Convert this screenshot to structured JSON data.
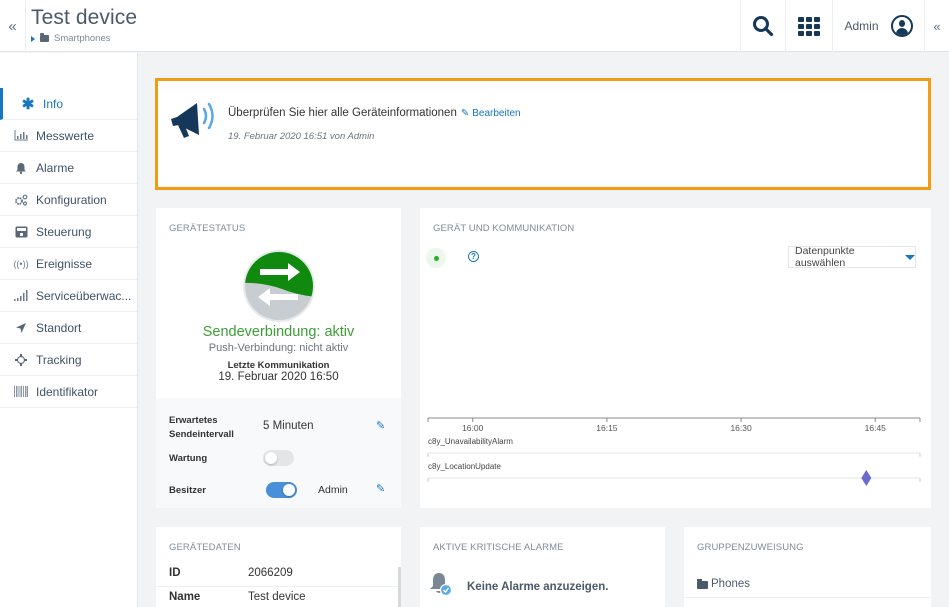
{
  "header": {
    "title": "Test device",
    "breadcrumb": "Smartphones",
    "user_label": "Admin",
    "icons": {
      "collapse_left": "«",
      "collapse_right": "«",
      "search": "search-icon",
      "apps": "apps-grid-icon",
      "user": "user-circle-icon"
    }
  },
  "sidebar": {
    "items": [
      {
        "label": "Info",
        "icon": "✱",
        "active": true
      },
      {
        "label": "Messwerte",
        "icon": "bar-chart"
      },
      {
        "label": "Alarme",
        "icon": "bell"
      },
      {
        "label": "Konfiguration",
        "icon": "gears"
      },
      {
        "label": "Steuerung",
        "icon": "control-panel"
      },
      {
        "label": "Ereignisse",
        "icon": "((•))"
      },
      {
        "label": "Serviceüberwac...",
        "icon": "signal"
      },
      {
        "label": "Standort",
        "icon": "location-arrow"
      },
      {
        "label": "Tracking",
        "icon": "crosshair"
      },
      {
        "label": "Identifikator",
        "icon": "barcode"
      }
    ]
  },
  "info": {
    "message": "Überprüfen Sie hier alle Geräteinformationen",
    "edit_label": "Bearbeiten",
    "date": "19. Februar 2020 16:51 von Admin",
    "border_color": "#f39c12"
  },
  "status": {
    "title": "Gerätestatus",
    "send_connection": "Sendeverbindung: aktiv",
    "push_connection": "Push-Verbindung: nicht aktiv",
    "last_comm_label": "Letzte Kommunikation",
    "last_comm_value": "19. Februar 2020 16:50",
    "interval_label_1": "Erwartetes",
    "interval_label_2": "Sendeintervall",
    "interval_value": "5 Minuten",
    "maintenance_label": "Wartung",
    "maintenance_on": false,
    "owner_label": "Besitzer",
    "owner_on": true,
    "owner_value": "Admin",
    "colors": {
      "active": "#3c9e35",
      "green": "#0f8a0f",
      "grey": "#c8cdd2"
    }
  },
  "communication": {
    "title": "Gerät und Kommunikation",
    "select_label": "Datenpunkte auswählen",
    "help_glyph": "?",
    "axis_ticks": [
      "16:00",
      "16:15",
      "16:30",
      "16:45"
    ],
    "axis_range": [
      "15:55",
      "16:50"
    ],
    "rows": [
      {
        "label": "c8y_UnavailabilityAlarm",
        "events": []
      },
      {
        "label": "c8y_LocationUpdate",
        "events": [
          "16:44"
        ]
      }
    ],
    "event_color": "#6a6acf"
  },
  "device_data": {
    "title": "Gerätedaten",
    "rows": [
      {
        "key": "ID",
        "value": "2066209"
      },
      {
        "key": "Name",
        "value": "Test device"
      }
    ]
  },
  "alarms": {
    "title": "Aktive kritische Alarme",
    "empty_text": "Keine Alarme anzuzeigen."
  },
  "groups": {
    "title": "Gruppenzuweisung",
    "items": [
      {
        "label": "Phones"
      }
    ]
  }
}
